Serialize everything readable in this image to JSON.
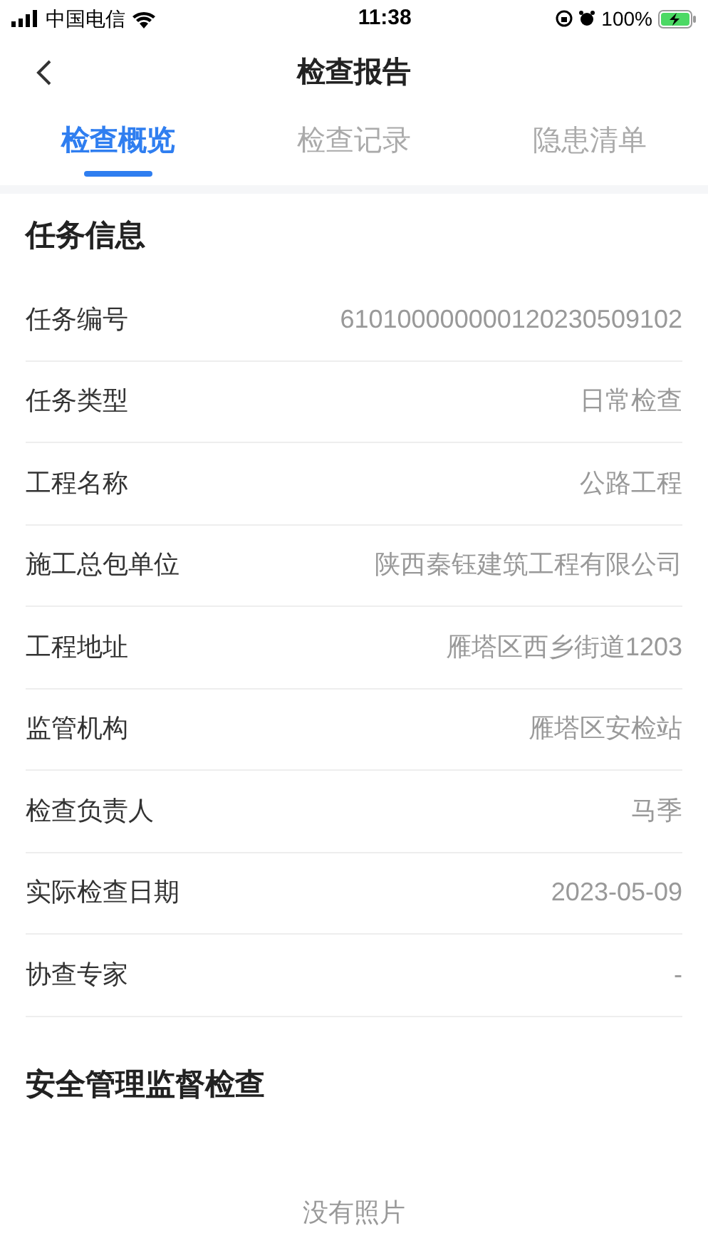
{
  "status_bar": {
    "carrier": "中国电信",
    "time": "11:38",
    "battery": "100%"
  },
  "nav": {
    "title": "检查报告"
  },
  "tabs": [
    {
      "label": "检查概览",
      "selected": true
    },
    {
      "label": "检查记录",
      "selected": false
    },
    {
      "label": "隐患清单",
      "selected": false
    }
  ],
  "task_info": {
    "title": "任务信息",
    "rows": [
      {
        "label": "任务编号",
        "value": "610100000000120230509102"
      },
      {
        "label": "任务类型",
        "value": "日常检查"
      },
      {
        "label": "工程名称",
        "value": "公路工程"
      },
      {
        "label": "施工总包单位",
        "value": "陕西秦钰建筑工程有限公司"
      },
      {
        "label": "工程地址",
        "value": "雁塔区西乡街道1203"
      },
      {
        "label": "监管机构",
        "value": "雁塔区安检站"
      },
      {
        "label": "检查负责人",
        "value": "马季"
      },
      {
        "label": "实际检查日期",
        "value": "2023-05-09"
      },
      {
        "label": "协查专家",
        "value": "-"
      }
    ]
  },
  "safety_section": {
    "title": "安全管理监督检查",
    "empty_text": "没有照片"
  }
}
